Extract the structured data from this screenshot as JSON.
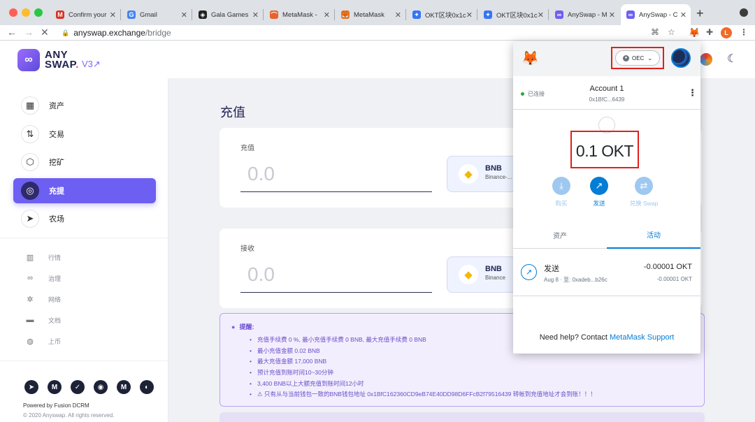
{
  "browser": {
    "tabs": [
      {
        "label": "Confirm your",
        "icon": "gmail-icon",
        "color": "#d93025",
        "glyph": "M"
      },
      {
        "label": "Gmail",
        "icon": "google-icon",
        "color": "#4285f4",
        "glyph": "G"
      },
      {
        "label": "Gala Games",
        "icon": "gala-icon",
        "color": "#222222",
        "glyph": "◈"
      },
      {
        "label": "MetaMask -",
        "icon": "rainbow-icon",
        "color": "#e8632b",
        "glyph": "⌒"
      },
      {
        "label": "MetaMask",
        "icon": "fox-icon",
        "color": "#e2761b",
        "glyph": "🦊"
      },
      {
        "label": "OKT区块0x1c",
        "icon": "okex-icon",
        "color": "#3575f6",
        "glyph": "✦"
      },
      {
        "label": "OKT区块0x1c",
        "icon": "okex-icon",
        "color": "#3575f6",
        "glyph": "✦"
      },
      {
        "label": "AnySwap - M",
        "icon": "anyswap-icon",
        "color": "#6d5ff2",
        "glyph": "∞"
      },
      {
        "label": "AnySwap - C",
        "icon": "anyswap-icon",
        "color": "#6d5ff2",
        "glyph": "∞"
      }
    ],
    "url_host": "anyswap.exchange",
    "url_path": "/bridge",
    "profile_initial": "L"
  },
  "app": {
    "logo_line1": "ANY",
    "logo_line2": "SWAP",
    "logo_dot": ".",
    "version": "V3↗",
    "nav": [
      {
        "label": "资产",
        "icon": "grid-icon",
        "glyph": "▦"
      },
      {
        "label": "交易",
        "icon": "exchange-icon",
        "glyph": "⇅"
      },
      {
        "label": "挖矿",
        "icon": "mining-icon",
        "glyph": "⬡"
      },
      {
        "label": "充提",
        "icon": "bridge-icon",
        "glyph": "◎"
      },
      {
        "label": "农场",
        "icon": "send-icon",
        "glyph": "➤"
      }
    ],
    "subnav": [
      {
        "label": "行情",
        "icon": "chart-icon",
        "glyph": "▥"
      },
      {
        "label": "治理",
        "icon": "link-icon",
        "glyph": "∞"
      },
      {
        "label": "网络",
        "icon": "network-icon",
        "glyph": "✲"
      },
      {
        "label": "文档",
        "icon": "folder-icon",
        "glyph": "▬"
      },
      {
        "label": "上币",
        "icon": "coin-icon",
        "glyph": "◍"
      }
    ],
    "social": [
      {
        "icon": "telegram-icon",
        "glyph": "➤"
      },
      {
        "icon": "medium-icon",
        "glyph": "M"
      },
      {
        "icon": "twitter-icon",
        "glyph": "✓"
      },
      {
        "icon": "github-icon",
        "glyph": "◉"
      },
      {
        "icon": "coinmarketcap-icon",
        "glyph": "M"
      },
      {
        "icon": "coingecko-icon",
        "glyph": "◐"
      }
    ],
    "powered_by": "Powered by Fusion DCRM",
    "copyright": "© 2020 Anyswap. All rights reserved."
  },
  "bridge": {
    "title": "充值",
    "deposit": {
      "label": "充值",
      "placeholder": "0.0",
      "token_symbol": "BNB",
      "token_name": "Binance-..."
    },
    "receive": {
      "label": "接收",
      "placeholder": "0.0",
      "token_symbol": "BNB",
      "token_name": "Binance"
    },
    "tips_title": "提醒:",
    "tips": [
      "充值手续费 0 %, 最小充值手续费 0 BNB, 最大充值手续费 0 BNB",
      "最小充值金额 0.02 BNB",
      "最大充值金额 17,000 BNB",
      "预计充值到账时间10~30分钟",
      "3,400 BNB以上大额充值到账时间12小时",
      "⚠ 只有从与当前钱包一致的BNB钱包地址 0x1BfC162360CD9eB74E40DD98D6FFcB2f79516439 转帐到充值地址才会到账！！！"
    ]
  },
  "metamask": {
    "network": "OEC",
    "connected": "已连接",
    "account_name": "Account 1",
    "account_addr": "0x1BfC...6439",
    "balance": "0.1 OKT",
    "actions": [
      {
        "label": "购买",
        "icon": "download-icon",
        "glyph": "⤓",
        "color": "#9ec8ef",
        "text_color": "#9ec8ef"
      },
      {
        "label": "发送",
        "icon": "send-arrow-icon",
        "glyph": "↗",
        "color": "#037dd6",
        "text_color": "#037dd6"
      },
      {
        "label": "兑换 Swap",
        "icon": "swap-icon",
        "glyph": "⇄",
        "color": "#9ec8ef",
        "text_color": "#9ec8ef"
      }
    ],
    "tab_assets": "资产",
    "tab_activity": "活动",
    "tx": {
      "title": "发送",
      "meta": "Aug 8 · 至: 0xadeb...b26c",
      "amount": "-0.00001 OKT",
      "amount_fiat": "-0.00001 OKT"
    },
    "help_prefix": "Need help? Contact ",
    "help_link": "MetaMask Support"
  }
}
